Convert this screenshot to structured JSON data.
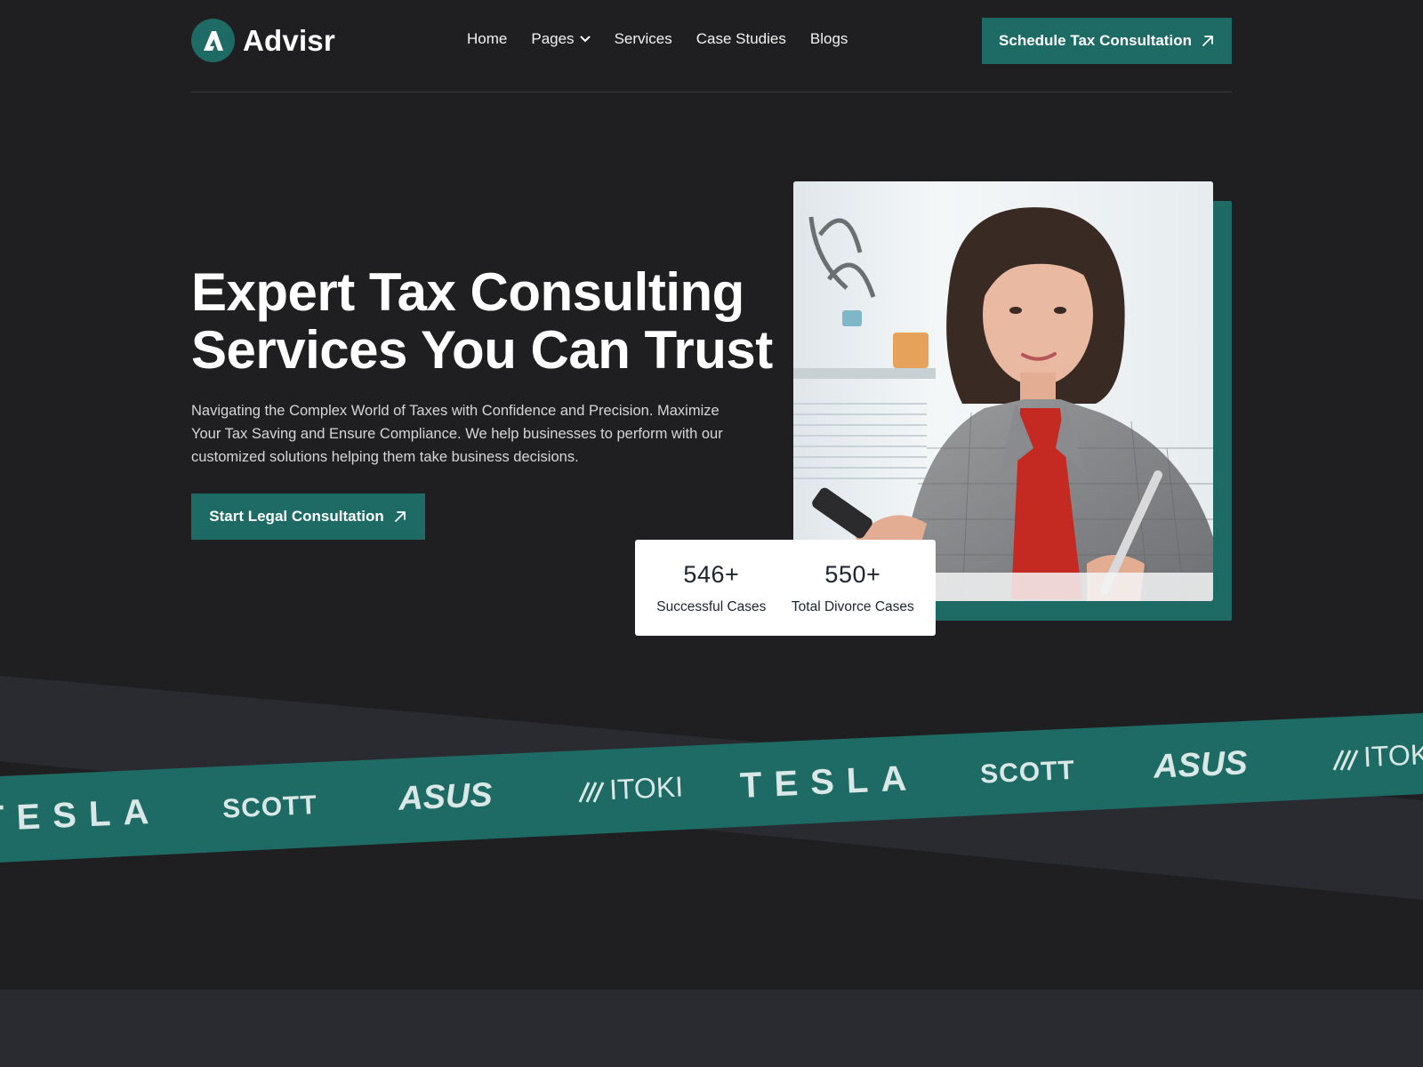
{
  "brand": {
    "name": "Advisr",
    "logo_letter": "A",
    "accent": "#1d6b64"
  },
  "nav": {
    "items": [
      {
        "label": "Home"
      },
      {
        "label": "Pages",
        "has_dropdown": true
      },
      {
        "label": "Services"
      },
      {
        "label": "Case Studies"
      },
      {
        "label": "Blogs"
      }
    ],
    "cta_label": "Schedule Tax Consultation"
  },
  "hero": {
    "title_line1": "Expert Tax Consulting",
    "title_line2": "Services You Can Trust",
    "description": "Navigating the Complex World of Taxes with Confidence and Precision. Maximize Your Tax Saving and Ensure Compliance. We help businesses to perform with our customized solutions helping them take business decisions.",
    "cta_label": "Start Legal Consultation"
  },
  "stats": [
    {
      "value": "546+",
      "label": "Successful Cases"
    },
    {
      "value": "550+",
      "label": "Total Divorce Cases"
    }
  ],
  "logos": [
    "TESLA",
    "SCOTT",
    "ASUS",
    "ITOKI",
    "TESLA",
    "SCOTT",
    "ASUS",
    "ITOKI"
  ],
  "colors": {
    "background": "#1f1f21",
    "band": "#1d6b64",
    "band_shadow": "#2a2b30",
    "logo_tint": "#d9e8e6"
  }
}
